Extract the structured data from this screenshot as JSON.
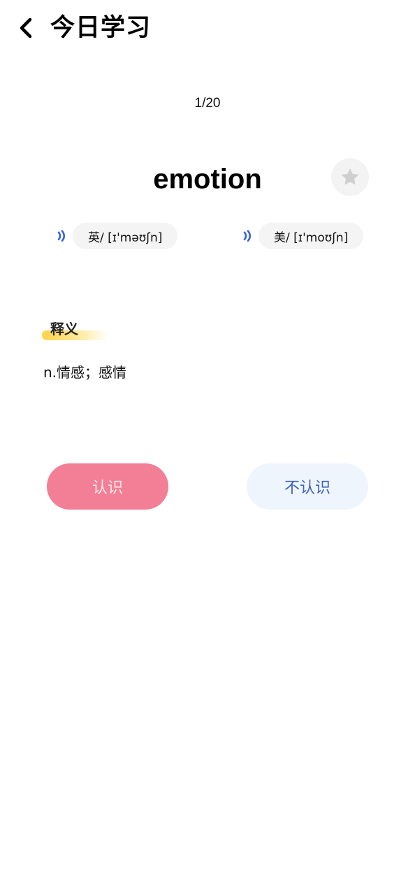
{
  "header": {
    "back_icon": "chevron-left-icon",
    "title": "今日学习"
  },
  "progress": "1/20",
  "word": {
    "text": "emotion",
    "favorite_icon": "star-icon"
  },
  "pronunciations": [
    {
      "label": "英/ [ɪ'məʊʃn]",
      "icon": "speaker-icon"
    },
    {
      "label": "美/ [ɪ'moʊʃn]",
      "icon": "speaker-icon"
    }
  ],
  "definition": {
    "heading": "释义",
    "text": "n.情感；感情"
  },
  "actions": {
    "know_label": "认识",
    "unknown_label": "不认识"
  },
  "colors": {
    "know_button": "#f27f95",
    "unknown_button": "#eef5fd",
    "unknown_text": "#3f63b9",
    "speaker_icon": "#3a63d6",
    "heading_highlight": "#ffd24a"
  }
}
